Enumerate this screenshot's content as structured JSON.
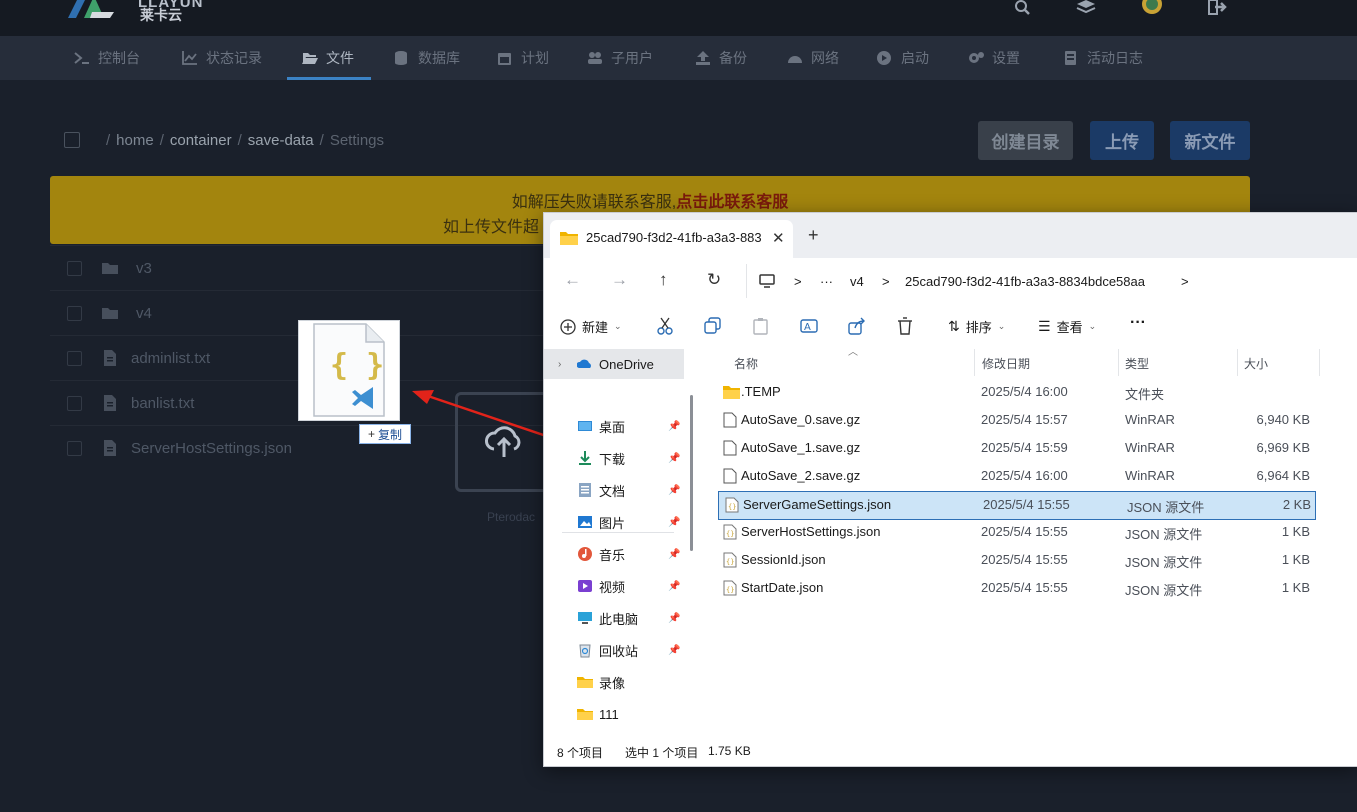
{
  "header": {
    "logo_text": "LLAYUN",
    "logo_sub": "莱卡云",
    "icons": [
      "search-icon",
      "layers-icon",
      "avatar-icon",
      "logout-icon"
    ]
  },
  "nav": {
    "items": [
      {
        "label": "控制台",
        "icon": "terminal-icon"
      },
      {
        "label": "状态记录",
        "icon": "chart-icon"
      },
      {
        "label": "文件",
        "icon": "folder-open-icon",
        "active": true
      },
      {
        "label": "数据库",
        "icon": "database-icon"
      },
      {
        "label": "计划",
        "icon": "calendar-icon"
      },
      {
        "label": "子用户",
        "icon": "users-icon"
      },
      {
        "label": "备份",
        "icon": "upload-icon"
      },
      {
        "label": "网络",
        "icon": "network-icon"
      },
      {
        "label": "启动",
        "icon": "play-icon"
      },
      {
        "label": "设置",
        "icon": "cogs-icon"
      },
      {
        "label": "活动日志",
        "icon": "log-icon"
      }
    ]
  },
  "breadcrumb": {
    "sep": "/",
    "segments": [
      "home",
      "container",
      "save-data",
      "Settings"
    ]
  },
  "actions": {
    "create_dir": "创建目录",
    "upload": "上传",
    "new_file": "新文件"
  },
  "banner": {
    "line1_prefix": "如解压失败请联系客服,",
    "line1_link": "点击此联系客服",
    "line2": "如上传文件超"
  },
  "files": [
    {
      "name": "v3",
      "type": "folder"
    },
    {
      "name": "v4",
      "type": "folder"
    },
    {
      "name": "adminlist.txt",
      "type": "file"
    },
    {
      "name": "banlist.txt",
      "type": "file"
    },
    {
      "name": "ServerHostSettings.json",
      "type": "file"
    }
  ],
  "drag": {
    "copy_label": "复制",
    "plus": "+"
  },
  "upload_zone": {
    "caption": "Pterodac"
  },
  "explorer": {
    "tab_title": "25cad790-f3d2-41fb-a3a3-883",
    "tab_close": "✕",
    "tab_new": "+",
    "nav": {
      "back": "←",
      "forward": "→",
      "up": "↑",
      "refresh": "↻"
    },
    "address": {
      "sep": ">",
      "more": "···",
      "v4": "v4",
      "folder": "25cad790-f3d2-41fb-a3a3-8834bdce58aa"
    },
    "commands": {
      "new": "新建",
      "sort": "排序",
      "view": "查看",
      "more": "···"
    },
    "sidebar": [
      {
        "label": "OneDrive",
        "icon": "onedrive-icon",
        "pinned": false
      },
      {
        "label": "桌面",
        "icon": "desktop-icon",
        "pinned": true
      },
      {
        "label": "下载",
        "icon": "download-icon",
        "pinned": true
      },
      {
        "label": "文档",
        "icon": "document-icon",
        "pinned": true
      },
      {
        "label": "图片",
        "icon": "pictures-icon",
        "pinned": true
      },
      {
        "label": "音乐",
        "icon": "music-icon",
        "pinned": true
      },
      {
        "label": "视频",
        "icon": "video-icon",
        "pinned": true
      },
      {
        "label": "此电脑",
        "icon": "computer-icon",
        "pinned": true
      },
      {
        "label": "回收站",
        "icon": "recycle-bin-icon",
        "pinned": true
      },
      {
        "label": "录像",
        "icon": "folder-icon",
        "pinned": false
      },
      {
        "label": "111",
        "icon": "folder-icon",
        "pinned": false
      }
    ],
    "columns": {
      "name": "名称",
      "date": "修改日期",
      "type": "类型",
      "size": "大小"
    },
    "rows": [
      {
        "name": ".TEMP",
        "date": "2025/5/4 16:00",
        "type": "文件夹",
        "size": "",
        "kind": "folder"
      },
      {
        "name": "AutoSave_0.save.gz",
        "date": "2025/5/4 15:57",
        "type": "WinRAR",
        "size": "6,940 KB",
        "kind": "file"
      },
      {
        "name": "AutoSave_1.save.gz",
        "date": "2025/5/4 15:59",
        "type": "WinRAR",
        "size": "6,969 KB",
        "kind": "file"
      },
      {
        "name": "AutoSave_2.save.gz",
        "date": "2025/5/4 16:00",
        "type": "WinRAR",
        "size": "6,964 KB",
        "kind": "file"
      },
      {
        "name": "ServerGameSettings.json",
        "date": "2025/5/4 15:55",
        "type": "JSON 源文件",
        "size": "2 KB",
        "kind": "json",
        "selected": true
      },
      {
        "name": "ServerHostSettings.json",
        "date": "2025/5/4 15:55",
        "type": "JSON 源文件",
        "size": "1 KB",
        "kind": "json"
      },
      {
        "name": "SessionId.json",
        "date": "2025/5/4 15:55",
        "type": "JSON 源文件",
        "size": "1 KB",
        "kind": "json"
      },
      {
        "name": "StartDate.json",
        "date": "2025/5/4 15:55",
        "type": "JSON 源文件",
        "size": "1 KB",
        "kind": "json"
      }
    ],
    "status": {
      "count": "8 个项目",
      "selected": "选中 1 个项目",
      "size": "1.75 KB"
    }
  },
  "colors": {
    "accent": "#3b82c4",
    "banner": "#a3850e",
    "selection": "#cce4f7"
  }
}
